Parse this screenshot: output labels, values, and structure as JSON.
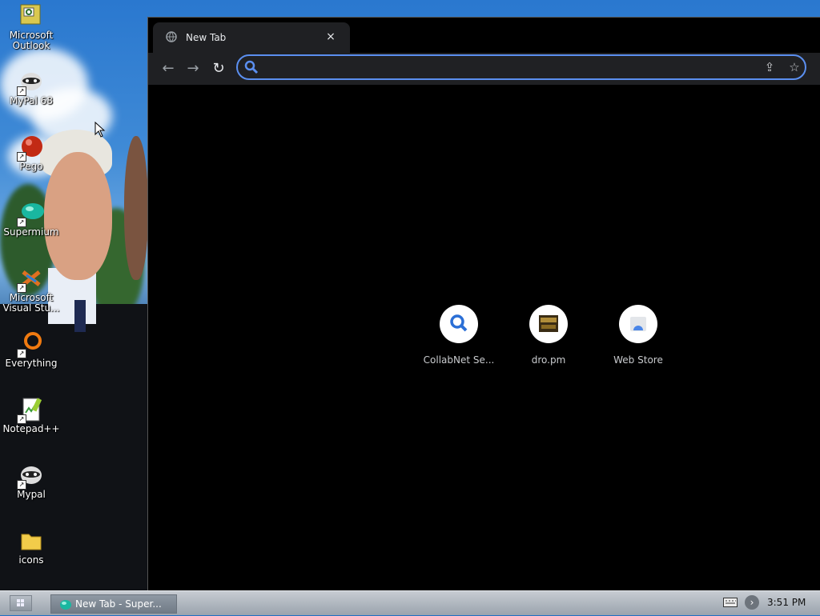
{
  "desktop": {
    "icons": [
      {
        "name": "outlook",
        "label": "Microsoft Outlook",
        "line1": "Microsoft",
        "line2": "Outlook"
      },
      {
        "name": "mypal-68",
        "label": "MyPal 68",
        "line1": "MyPal 68",
        "line2": ""
      },
      {
        "name": "pego",
        "label": "Pego",
        "line1": "Pego",
        "line2": ""
      },
      {
        "name": "supermium",
        "label": "Supermium",
        "line1": "Supermium",
        "line2": ""
      },
      {
        "name": "visual-studio",
        "label": "Microsoft Visual Stu...",
        "line1": "Microsoft",
        "line2": "Visual Stu..."
      },
      {
        "name": "everything",
        "label": "Everything",
        "line1": "Everything",
        "line2": ""
      },
      {
        "name": "notepad-plus-plus",
        "label": "Notepad++",
        "line1": "Notepad++",
        "line2": ""
      },
      {
        "name": "mypal",
        "label": "Mypal",
        "line1": "Mypal",
        "line2": ""
      },
      {
        "name": "icons-folder",
        "label": "icons",
        "line1": "icons",
        "line2": ""
      }
    ]
  },
  "browser": {
    "tab": {
      "title": "New Tab",
      "close_glyph": "×",
      "favicon": "globe-icon"
    },
    "toolbar": {
      "back_glyph": "←",
      "forward_glyph": "→",
      "reload_glyph": "↻",
      "omnibox_value": "",
      "omnibox_placeholder": "",
      "share_glyph": "⇪",
      "bookmark_glyph": "☆"
    },
    "shortcuts": [
      {
        "name": "collabnet-search",
        "label": "CollabNet Se...",
        "icon": "search-icon"
      },
      {
        "name": "dro-pm",
        "label": "dro.pm",
        "icon": "site-thumbnail-icon"
      },
      {
        "name": "web-store",
        "label": "Web Store",
        "icon": "web-store-icon"
      }
    ]
  },
  "taskbar": {
    "start_icon": "start-menu-icon",
    "task_label": "New Tab - Super...",
    "tray_expand_glyph": "›",
    "clock": "3:51 PM"
  },
  "colors": {
    "browser_bg": "#000000",
    "toolbar_bg": "#1f2023",
    "omnibox_focus": "#5b8ff0",
    "taskbar_top": "#c7ccd2",
    "taskbar_bottom": "#9aa3ad"
  }
}
